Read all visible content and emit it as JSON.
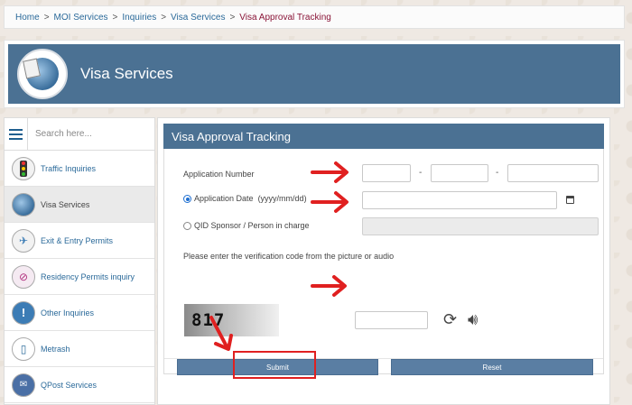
{
  "breadcrumb": {
    "items": [
      "Home",
      "MOI Services",
      "Inquiries",
      "Visa Services"
    ],
    "current": "Visa Approval Tracking",
    "separator": ">"
  },
  "banner": {
    "title": "Visa Services"
  },
  "sidebar": {
    "search_placeholder": "Search here...",
    "items": [
      {
        "label": "Traffic Inquiries",
        "icon": "traffic-light-icon"
      },
      {
        "label": "Visa Services",
        "icon": "visa-globe-icon",
        "active": true
      },
      {
        "label": "Exit & Entry Permits",
        "icon": "airplane-icon"
      },
      {
        "label": "Residency Permits inquiry",
        "icon": "residency-icon"
      },
      {
        "label": "Other Inquiries",
        "icon": "info-icon"
      },
      {
        "label": "Metrash",
        "icon": "metrash-phone-icon"
      },
      {
        "label": "QPost Services",
        "icon": "qpost-icon"
      }
    ]
  },
  "form": {
    "title": "Visa Approval Tracking",
    "application_number_label": "Application Number",
    "application_number_separator": "-",
    "application_number_values": [
      "",
      "",
      ""
    ],
    "application_date_label": "Application Date",
    "application_date_format": "(yyyy/mm/dd)",
    "application_date_value": "",
    "application_date_selected": true,
    "qid_label": "QID Sponsor / Person in charge",
    "qid_value": "",
    "qid_selected": false,
    "verification_prompt": "Please enter the verification code from the picture or audio",
    "captcha_text": "817",
    "captcha_value": "",
    "submit_label": "Submit",
    "reset_label": "Reset"
  },
  "colors": {
    "header_blue": "#4b7193",
    "button_blue": "#5a7ea3",
    "link_blue": "#2b6a9a",
    "breadcrumb_current": "#8a1538",
    "annotation_red": "#e02020"
  }
}
